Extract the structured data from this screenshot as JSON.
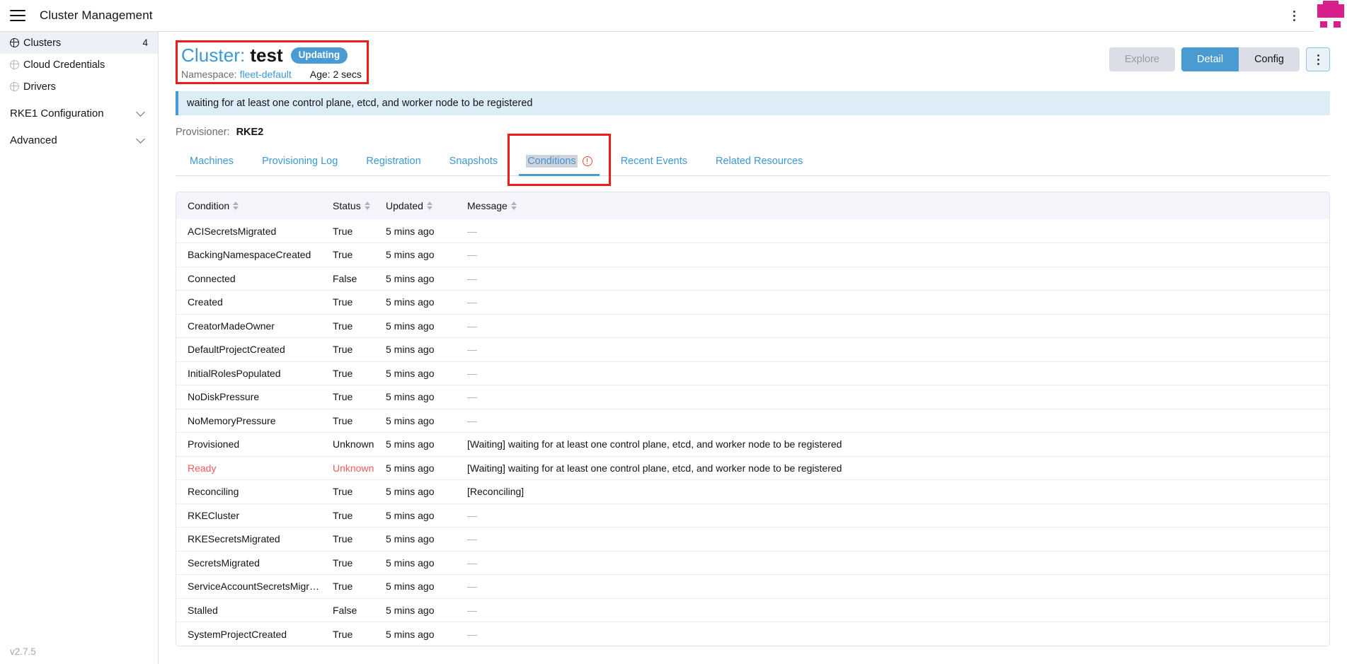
{
  "topbar": {
    "menu_icon": "hamburger-icon",
    "title": "Cluster Management",
    "kebab_icon": "vertical-dots-icon",
    "logo": "rancher-logo"
  },
  "sidebar": {
    "items": [
      {
        "label": "Clusters",
        "count": "4",
        "icon": "globe-icon",
        "active": true
      },
      {
        "label": "Cloud Credentials",
        "count": "",
        "icon": "globe-icon",
        "active": false
      },
      {
        "label": "Drivers",
        "count": "",
        "icon": "globe-icon",
        "active": false
      }
    ],
    "groups": [
      {
        "label": "RKE1 Configuration",
        "icon": "chevron-down-icon"
      },
      {
        "label": "Advanced",
        "icon": "chevron-down-icon"
      }
    ],
    "version": "v2.7.5"
  },
  "header": {
    "title_prefix": "Cluster:",
    "title_name": "test",
    "status_badge": "Updating",
    "namespace_label": "Namespace:",
    "namespace_value": "fleet-default",
    "age": "Age: 2 secs",
    "actions": {
      "explore": "Explore",
      "detail": "Detail",
      "config": "Config",
      "kebab_icon": "vertical-dots-icon"
    }
  },
  "banner": {
    "message": "waiting for at least one control plane, etcd, and worker node to be registered"
  },
  "provisioner": {
    "label": "Provisioner:",
    "value": "RKE2"
  },
  "tabs": [
    {
      "label": "Machines",
      "active": false,
      "warn": false
    },
    {
      "label": "Provisioning Log",
      "active": false,
      "warn": false
    },
    {
      "label": "Registration",
      "active": false,
      "warn": false
    },
    {
      "label": "Snapshots",
      "active": false,
      "warn": false
    },
    {
      "label": "Conditions",
      "active": true,
      "warn": true
    },
    {
      "label": "Recent Events",
      "active": false,
      "warn": false
    },
    {
      "label": "Related Resources",
      "active": false,
      "warn": false
    }
  ],
  "table": {
    "columns": [
      "Condition",
      "Status",
      "Updated",
      "Message"
    ],
    "rows": [
      {
        "condition": "ACISecretsMigrated",
        "status": "True",
        "updated": "5 mins ago",
        "message": "—",
        "error": false
      },
      {
        "condition": "BackingNamespaceCreated",
        "status": "True",
        "updated": "5 mins ago",
        "message": "—",
        "error": false
      },
      {
        "condition": "Connected",
        "status": "False",
        "updated": "5 mins ago",
        "message": "—",
        "error": false
      },
      {
        "condition": "Created",
        "status": "True",
        "updated": "5 mins ago",
        "message": "—",
        "error": false
      },
      {
        "condition": "CreatorMadeOwner",
        "status": "True",
        "updated": "5 mins ago",
        "message": "—",
        "error": false
      },
      {
        "condition": "DefaultProjectCreated",
        "status": "True",
        "updated": "5 mins ago",
        "message": "—",
        "error": false
      },
      {
        "condition": "InitialRolesPopulated",
        "status": "True",
        "updated": "5 mins ago",
        "message": "—",
        "error": false
      },
      {
        "condition": "NoDiskPressure",
        "status": "True",
        "updated": "5 mins ago",
        "message": "—",
        "error": false
      },
      {
        "condition": "NoMemoryPressure",
        "status": "True",
        "updated": "5 mins ago",
        "message": "—",
        "error": false
      },
      {
        "condition": "Provisioned",
        "status": "Unknown",
        "updated": "5 mins ago",
        "message": "[Waiting] waiting for at least one control plane, etcd, and worker node to be registered",
        "error": false
      },
      {
        "condition": "Ready",
        "status": "Unknown",
        "updated": "5 mins ago",
        "message": "[Waiting] waiting for at least one control plane, etcd, and worker node to be registered",
        "error": true
      },
      {
        "condition": "Reconciling",
        "status": "True",
        "updated": "5 mins ago",
        "message": "[Reconciling]",
        "error": false
      },
      {
        "condition": "RKECluster",
        "status": "True",
        "updated": "5 mins ago",
        "message": "—",
        "error": false
      },
      {
        "condition": "RKESecretsMigrated",
        "status": "True",
        "updated": "5 mins ago",
        "message": "—",
        "error": false
      },
      {
        "condition": "SecretsMigrated",
        "status": "True",
        "updated": "5 mins ago",
        "message": "—",
        "error": false
      },
      {
        "condition": "ServiceAccountSecretsMigrated",
        "status": "True",
        "updated": "5 mins ago",
        "message": "—",
        "error": false
      },
      {
        "condition": "Stalled",
        "status": "False",
        "updated": "5 mins ago",
        "message": "—",
        "error": false
      },
      {
        "condition": "SystemProjectCreated",
        "status": "True",
        "updated": "5 mins ago",
        "message": "—",
        "error": false
      }
    ]
  },
  "colors": {
    "accent_blue": "#4a9bd1",
    "link_blue": "#3d98d3",
    "error_red": "#f25c5c",
    "annotation_red": "#ef1c18",
    "brand_pink": "#d91f8c"
  }
}
